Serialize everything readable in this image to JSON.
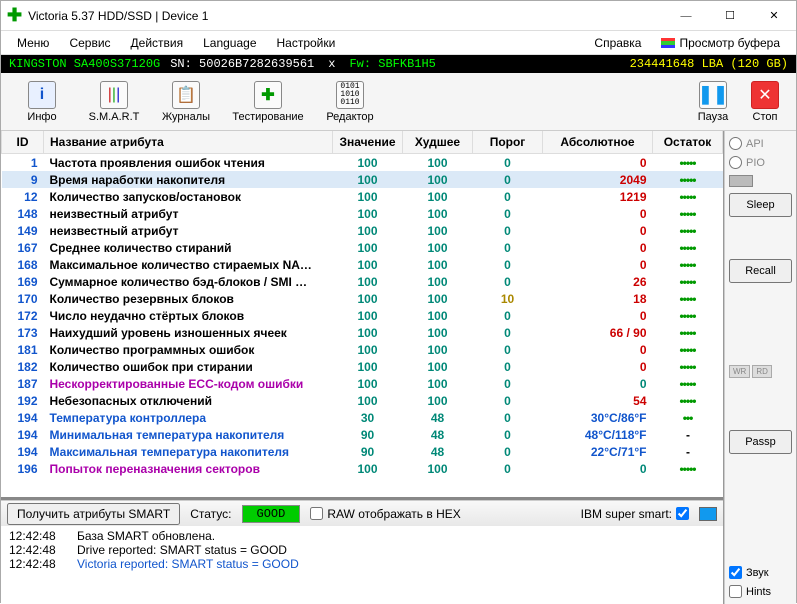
{
  "window": {
    "title": "Victoria 5.37 HDD/SSD | Device 1"
  },
  "menu": {
    "items": [
      "Меню",
      "Сервис",
      "Действия",
      "Language",
      "Настройки",
      "Справка"
    ],
    "buffer_view": "Просмотр буфера"
  },
  "driveinfo": {
    "model": "KINGSTON SA400S37120G",
    "sn": "SN: 50026B7282639561",
    "fw": "Fw: SBFKB1H5",
    "lba": "234441648 LBA (120 GB)"
  },
  "toolbar": {
    "info": "Инфо",
    "smart": "S.M.A.R.T",
    "journals": "Журналы",
    "testing": "Тестирование",
    "editor": "Редактор",
    "pause": "Пауза",
    "stop": "Стоп"
  },
  "columns": {
    "id": "ID",
    "name": "Название атрибута",
    "val": "Значение",
    "worst": "Худшее",
    "thr": "Порог",
    "abs": "Абсолютное",
    "rem": "Остаток"
  },
  "rows": [
    {
      "id": "1",
      "name": "Частота проявления ошибок чтения",
      "val": "100",
      "worst": "100",
      "thr": "0",
      "abs": "0",
      "abs_c": "abs-red",
      "rem": "•••••"
    },
    {
      "id": "9",
      "name": "Время наработки накопителя",
      "val": "100",
      "worst": "100",
      "thr": "0",
      "abs": "2049",
      "abs_c": "abs-red",
      "rem": "•••••",
      "sel": true
    },
    {
      "id": "12",
      "name": "Количество запусков/остановок",
      "val": "100",
      "worst": "100",
      "thr": "0",
      "abs": "1219",
      "abs_c": "abs-red",
      "rem": "•••••"
    },
    {
      "id": "148",
      "name": "неизвестный атрибут",
      "val": "100",
      "worst": "100",
      "thr": "0",
      "abs": "0",
      "abs_c": "abs-red",
      "rem": "•••••"
    },
    {
      "id": "149",
      "name": "неизвестный атрибут",
      "val": "100",
      "worst": "100",
      "thr": "0",
      "abs": "0",
      "abs_c": "abs-red",
      "rem": "•••••"
    },
    {
      "id": "167",
      "name": "Среднее количество стираний",
      "val": "100",
      "worst": "100",
      "thr": "0",
      "abs": "0",
      "abs_c": "abs-red",
      "rem": "•••••"
    },
    {
      "id": "168",
      "name": "Максимальное количество стираемых NA…",
      "val": "100",
      "worst": "100",
      "thr": "0",
      "abs": "0",
      "abs_c": "abs-red",
      "rem": "•••••"
    },
    {
      "id": "169",
      "name": "Суммарное количество бэд-блоков / SMI …",
      "val": "100",
      "worst": "100",
      "thr": "0",
      "abs": "26",
      "abs_c": "abs-red",
      "rem": "•••••"
    },
    {
      "id": "170",
      "name": "Количество резервных блоков",
      "val": "100",
      "worst": "100",
      "thr": "10",
      "thr_c": "warn",
      "abs": "18",
      "abs_c": "abs-red",
      "rem": "•••••"
    },
    {
      "id": "172",
      "name": "Число неудачно стёртых блоков",
      "val": "100",
      "worst": "100",
      "thr": "0",
      "abs": "0",
      "abs_c": "abs-red",
      "rem": "•••••"
    },
    {
      "id": "173",
      "name": "Наихудший уровень изношенных ячеек",
      "val": "100",
      "worst": "100",
      "thr": "0",
      "abs": "66 / 90",
      "abs_c": "abs-red",
      "rem": "•••••"
    },
    {
      "id": "181",
      "name": "Количество программных ошибок",
      "val": "100",
      "worst": "100",
      "thr": "0",
      "abs": "0",
      "abs_c": "abs-red",
      "rem": "•••••"
    },
    {
      "id": "182",
      "name": "Количество ошибок при стирании",
      "val": "100",
      "worst": "100",
      "thr": "0",
      "abs": "0",
      "abs_c": "abs-red",
      "rem": "•••••"
    },
    {
      "id": "187",
      "name": "Нескорректированные ECC-кодом ошибки",
      "name_c": "purple",
      "val": "100",
      "worst": "100",
      "thr": "0",
      "abs": "0",
      "abs_c": "abs-green",
      "rem": "•••••"
    },
    {
      "id": "192",
      "name": "Небезопасных отключений",
      "val": "100",
      "worst": "100",
      "thr": "0",
      "abs": "54",
      "abs_c": "abs-red",
      "rem": "•••••"
    },
    {
      "id": "194",
      "name": "Температура контроллера",
      "name_c": "blue",
      "val": "30",
      "worst": "48",
      "thr": "0",
      "abs": "30°C/86°F",
      "abs_c": "abs-blue",
      "rem": "•••",
      "rem_c": "warn"
    },
    {
      "id": "194",
      "name": "Минимальная температура накопителя",
      "name_c": "blue",
      "val": "90",
      "worst": "48",
      "thr": "0",
      "abs": "48°C/118°F",
      "abs_c": "abs-blue",
      "rem": "-",
      "rem_c": "dash"
    },
    {
      "id": "194",
      "name": "Максимальная температура накопителя",
      "name_c": "blue",
      "val": "90",
      "worst": "48",
      "thr": "0",
      "abs": "22°C/71°F",
      "abs_c": "abs-blue",
      "rem": "-",
      "rem_c": "dash"
    },
    {
      "id": "196",
      "name": "Попыток переназначения секторов",
      "name_c": "purple",
      "val": "100",
      "worst": "100",
      "thr": "0",
      "abs": "0",
      "abs_c": "abs-green",
      "rem": "•••••"
    }
  ],
  "bottom": {
    "get_attrs": "Получить атрибуты SMART",
    "status_lbl": "Статус:",
    "status_val": "GOOD",
    "raw_hex": "RAW отображать в HEX",
    "ibm": "IBM super smart:"
  },
  "log": [
    {
      "ts": "12:42:48",
      "msg": "База SMART обновлена."
    },
    {
      "ts": "12:42:48",
      "msg": "Drive reported: SMART status = GOOD"
    },
    {
      "ts": "12:42:48",
      "msg": "Victoria reported: SMART status = GOOD",
      "cls": "blue"
    }
  ],
  "side": {
    "api": "API",
    "pio": "PIO",
    "sleep": "Sleep",
    "recall": "Recall",
    "wr": "WR",
    "rd": "RD",
    "passp": "Passp",
    "sound": "Звук",
    "hints": "Hints"
  }
}
